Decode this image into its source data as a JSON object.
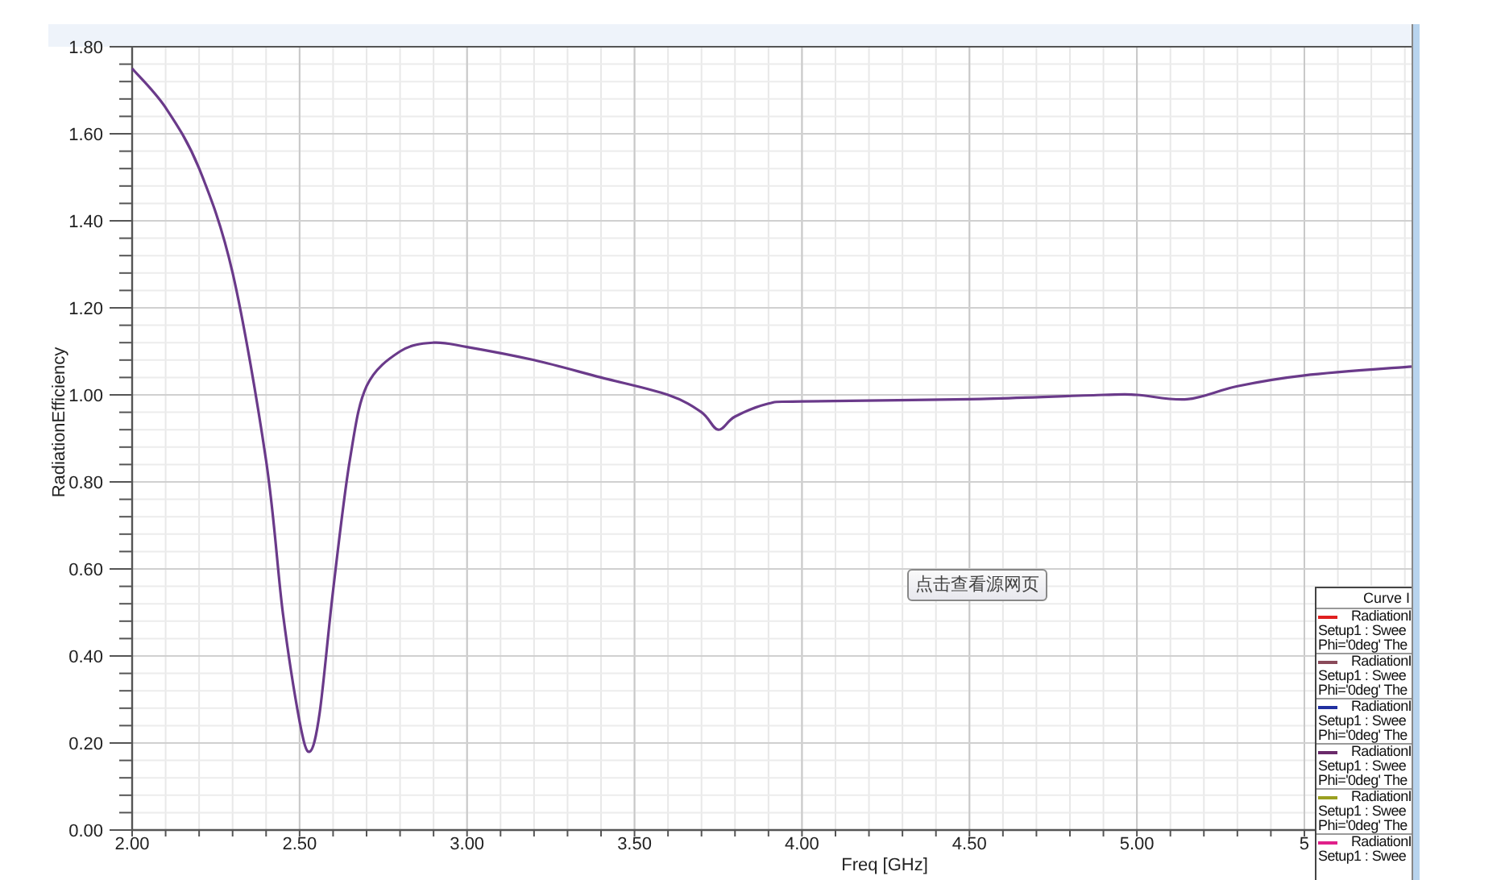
{
  "chart_data": {
    "type": "line",
    "grid": true,
    "ylabel": "RadiationEfficiency",
    "xlabel": "Freq [GHz]",
    "xlim": [
      2,
      5.82
    ],
    "ylim": [
      0,
      1.8
    ],
    "xticks": [
      {
        "value": 2,
        "label": "2.00"
      },
      {
        "value": 2.5,
        "label": "2.50"
      },
      {
        "value": 3,
        "label": "3.00"
      },
      {
        "value": 3.5,
        "label": "3.50"
      },
      {
        "value": 4,
        "label": "4.00"
      },
      {
        "value": 4.5,
        "label": "4.50"
      },
      {
        "value": 5,
        "label": "5.00"
      },
      {
        "value": 5.5,
        "label": "5"
      }
    ],
    "yticks": [
      {
        "value": 0,
        "label": "0.00"
      },
      {
        "value": 0.2,
        "label": "0.20"
      },
      {
        "value": 0.4,
        "label": "0.40"
      },
      {
        "value": 0.6,
        "label": "0.60"
      },
      {
        "value": 0.8,
        "label": "0.80"
      },
      {
        "value": 1,
        "label": "1.00"
      },
      {
        "value": 1.2,
        "label": "1.20"
      },
      {
        "value": 1.4,
        "label": "1.40"
      },
      {
        "value": 1.6,
        "label": "1.60"
      },
      {
        "value": 1.8,
        "label": "1.80"
      }
    ],
    "x": [
      2.0,
      2.1,
      2.2,
      2.3,
      2.4,
      2.45,
      2.5,
      2.53,
      2.56,
      2.6,
      2.65,
      2.7,
      2.8,
      2.9,
      3.0,
      3.2,
      3.4,
      3.6,
      3.7,
      3.75,
      3.8,
      3.9,
      4.0,
      4.5,
      4.9,
      5.0,
      5.15,
      5.3,
      5.5,
      5.82
    ],
    "series": [
      {
        "color": "#6a3a8a",
        "values": [
          1.75,
          1.66,
          1.52,
          1.28,
          0.85,
          0.5,
          0.25,
          0.18,
          0.27,
          0.55,
          0.85,
          1.02,
          1.1,
          1.12,
          1.11,
          1.08,
          1.04,
          1.0,
          0.96,
          0.92,
          0.95,
          0.98,
          0.985,
          0.99,
          1.0,
          1.0,
          0.99,
          1.02,
          1.045,
          1.065
        ]
      }
    ]
  },
  "overlay_button": {
    "label": "点击查看源网页"
  },
  "legend": {
    "title": "Curve I",
    "entries": [
      {
        "color": "#e02020",
        "lines": [
          "RadiationI",
          "Setup1 : Swee",
          "Phi='0deg' The"
        ]
      },
      {
        "color": "#8a4a5a",
        "lines": [
          "RadiationI",
          "Setup1 : Swee",
          "Phi='0deg' The"
        ]
      },
      {
        "color": "#2030a0",
        "lines": [
          "RadiationI",
          "Setup1 : Swee",
          "Phi='0deg' The"
        ]
      },
      {
        "color": "#6a2a6a",
        "lines": [
          "RadiationI",
          "Setup1 : Swee",
          "Phi='0deg' The"
        ]
      },
      {
        "color": "#9aa020",
        "lines": [
          "RadiationI",
          "Setup1 : Swee",
          "Phi='0deg' The"
        ]
      },
      {
        "color": "#e0208a",
        "lines": [
          "RadiationI",
          "Setup1 : Swee"
        ]
      }
    ]
  }
}
